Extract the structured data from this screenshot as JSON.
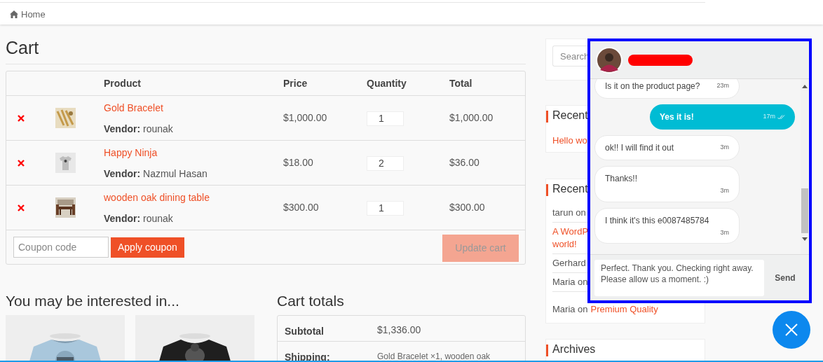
{
  "breadcrumb": {
    "label": "Home"
  },
  "cart": {
    "title": "Cart",
    "columns": [
      "Product",
      "Price",
      "Quantity",
      "Total"
    ],
    "items": [
      {
        "name": "Gold Bracelet",
        "vendor": "**Vendor:** rounak",
        "price": "$1,000.00",
        "quantity": "1",
        "total": "$1,000.00"
      },
      {
        "name": "Happy Ninja",
        "vendor": "**Vendor:** Nazmul Hasan",
        "price": "$18.00",
        "quantity": "2",
        "total": "$36.00"
      },
      {
        "name": "wooden oak dining table",
        "vendor": "**Vendor:** rounak",
        "price": "$300.00",
        "quantity": "1",
        "total": "$300.00"
      }
    ],
    "coupon": {
      "placeholder": "Coupon code"
    },
    "apply_button": "Apply coupon",
    "update_button": {
      "label": "Update cart",
      "disabled": true
    }
  },
  "related": {
    "title": "You may be interested in..."
  },
  "totals": {
    "title": "Cart totals",
    "rows": [
      {
        "label": "Subtotal",
        "value": "$1,336.00"
      },
      {
        "label": "Shipping:",
        "value": "Gold Bracelet ×1, wooden oak"
      }
    ]
  },
  "sidebar": {
    "search": {
      "placeholder": "Search"
    },
    "widgets": [
      {
        "title": "Recent",
        "items": [
          {
            "parts": [
              {
                "text": "Hello wo",
                "link": true
              }
            ]
          }
        ]
      },
      {
        "title": "Recent",
        "items": [
          {
            "parts": [
              {
                "text": "tarun on",
                "link": false
              }
            ]
          },
          {
            "parts": [
              {
                "text": "A WordP",
                "link": true
              },
              {
                "text": "world!",
                "link": true
              }
            ]
          },
          {
            "parts": [
              {
                "text": "Gerhard",
                "link": false
              }
            ]
          },
          {
            "parts": [
              {
                "text": "Maria on",
                "link": false
              }
            ]
          },
          {
            "parts": [
              {
                "text": "Maria on",
                "link": false
              },
              {
                "text": "Premium Quality",
                "link": true
              }
            ]
          }
        ]
      },
      {
        "title": "Archives"
      }
    ]
  },
  "chat": {
    "messages": [
      {
        "text": "Is it on the product page?",
        "time": "23m",
        "outgoing": false,
        "ticks": false
      },
      {
        "text": "Yes it is!",
        "time": "17m",
        "outgoing": true,
        "ticks": true
      },
      {
        "text": "ok!! I will find it out",
        "time": "3m",
        "outgoing": false,
        "ticks": false
      },
      {
        "text": "Thanks!!",
        "time": "3m",
        "outgoing": false,
        "ticks": false,
        "stacked": true
      },
      {
        "text": "I think it's this e0087485784",
        "time": "3m",
        "outgoing": false,
        "ticks": false,
        "stacked": true
      }
    ],
    "composer": {
      "value": "Perfect. Thank you. Checking right away. Please allow us a moment. :)"
    },
    "send_button": "Send"
  }
}
